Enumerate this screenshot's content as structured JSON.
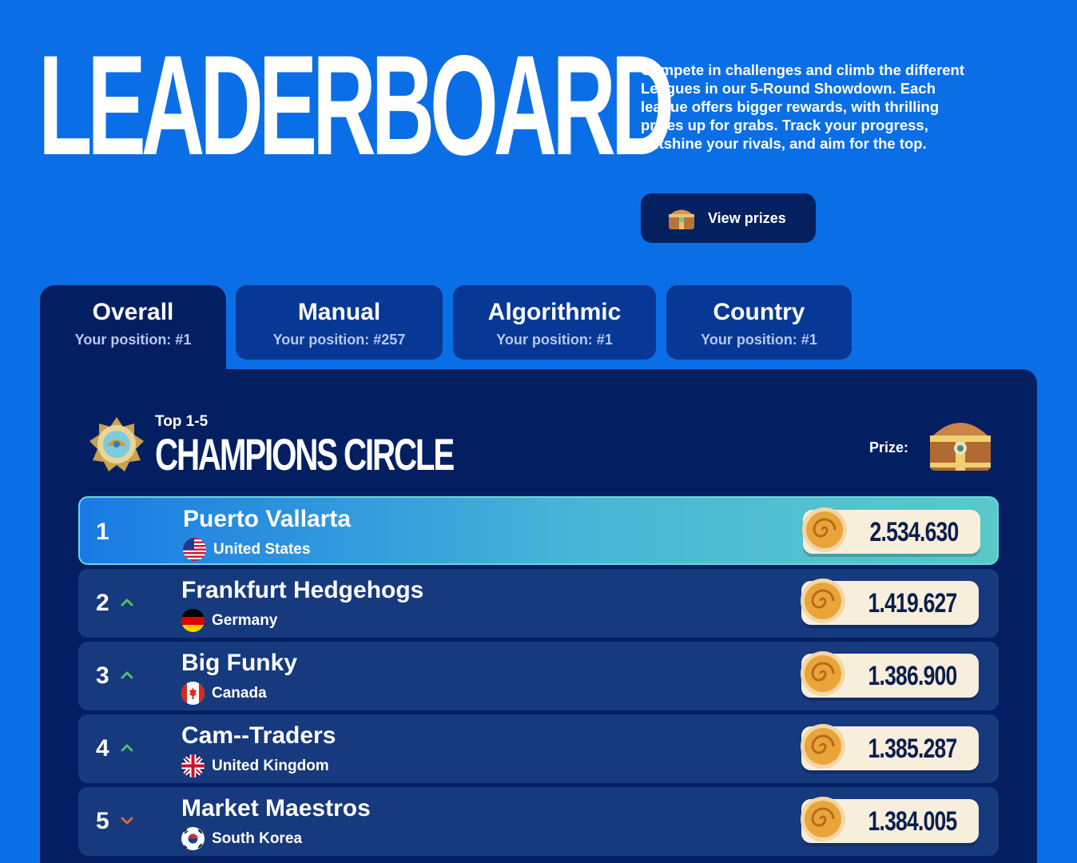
{
  "header": {
    "title": "LEADERBOARD",
    "description": "Compete in challenges and climb the different Leagues in our 5-Round Showdown. Each league offers bigger rewards, with thrilling prizes up for grabs. Track your progress, outshine your rivals, and aim for the top.",
    "view_prizes_label": "View prizes"
  },
  "tabs": [
    {
      "name": "Overall",
      "position": "Your position: #1",
      "active": true
    },
    {
      "name": "Manual",
      "position": "Your position: #257",
      "active": false
    },
    {
      "name": "Algorithmic",
      "position": "Your position: #1",
      "active": false
    },
    {
      "name": "Country",
      "position": "Your position: #1",
      "active": false
    }
  ],
  "league": {
    "range": "Top 1-5",
    "name": "CHAMPIONS CIRCLE",
    "prize_label": "Prize:"
  },
  "rows": [
    {
      "rank": "1",
      "trend": "none",
      "team": "Puerto Vallarta",
      "country": "United States",
      "flag": "us-flag-icon",
      "score": "2.534.630"
    },
    {
      "rank": "2",
      "trend": "up",
      "team": "Frankfurt Hedgehogs",
      "country": "Germany",
      "flag": "germany-flag-icon",
      "score": "1.419.627"
    },
    {
      "rank": "3",
      "trend": "up",
      "team": "Big Funky",
      "country": "Canada",
      "flag": "canada-flag-icon",
      "score": "1.386.900"
    },
    {
      "rank": "4",
      "trend": "up",
      "team": "Cam--Traders",
      "country": "United Kingdom",
      "flag": "uk-flag-icon",
      "score": "1.385.287"
    },
    {
      "rank": "5",
      "trend": "down",
      "team": "Market Maestros",
      "country": "South Korea",
      "flag": "south-korea-flag-icon",
      "score": "1.384.005"
    }
  ],
  "colors": {
    "background": "#0a6fe6",
    "panel": "#041f61",
    "row": "#17397d",
    "trend_up": "#4cc26a",
    "trend_down": "#e0672a",
    "score_pill": "#f7efdc"
  }
}
